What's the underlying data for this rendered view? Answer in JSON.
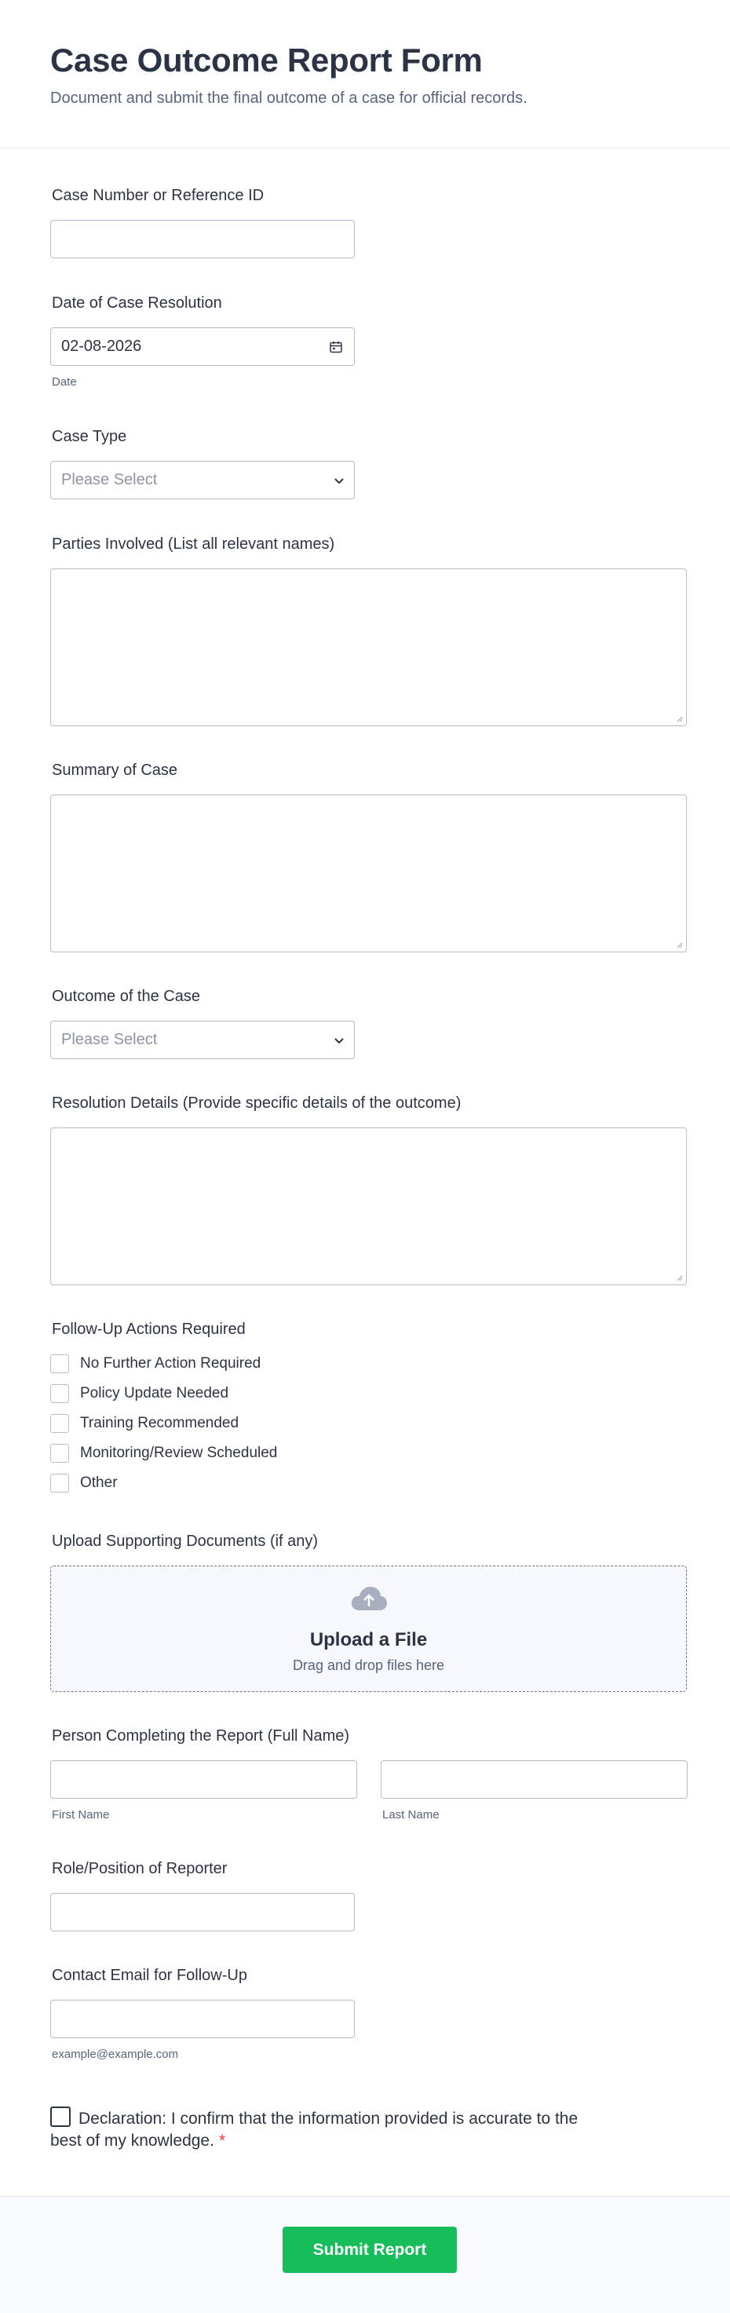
{
  "header": {
    "title": "Case Outcome Report Form",
    "subtitle": "Document and submit the final outcome of a case for official records."
  },
  "fields": {
    "case_number": {
      "label": "Case Number or Reference ID",
      "value": ""
    },
    "resolution_date": {
      "label": "Date of Case Resolution",
      "value": "02-08-2026",
      "sublabel": "Date",
      "icon": "calendar-icon"
    },
    "case_type": {
      "label": "Case Type",
      "placeholder": "Please Select"
    },
    "parties": {
      "label": "Parties Involved (List all relevant names)",
      "value": ""
    },
    "summary": {
      "label": "Summary of Case",
      "value": ""
    },
    "outcome": {
      "label": "Outcome of the Case",
      "placeholder": "Please Select"
    },
    "resolution_details": {
      "label": "Resolution Details (Provide specific details of the outcome)",
      "value": ""
    },
    "follow_up": {
      "label": "Follow-Up Actions Required",
      "options": [
        "No Further Action Required",
        "Policy Update Needed",
        "Training Recommended",
        "Monitoring/Review Scheduled",
        "Other"
      ]
    },
    "upload": {
      "label": "Upload Supporting Documents (if any)",
      "title": "Upload a File",
      "subtitle": "Drag and drop files here",
      "icon": "cloud-upload-icon"
    },
    "person": {
      "label": "Person Completing the Report (Full Name)",
      "first_sublabel": "First Name",
      "last_sublabel": "Last Name"
    },
    "role": {
      "label": "Role/Position of Reporter",
      "value": ""
    },
    "email": {
      "label": "Contact Email for Follow-Up",
      "sublabel": "example@example.com",
      "value": ""
    },
    "declaration": {
      "text": "Declaration: I confirm that the information provided is accurate to the best of my knowledge.",
      "required_mark": "*"
    }
  },
  "footer": {
    "submit_label": "Submit Report"
  },
  "colors": {
    "accent": "#18bd5b",
    "required": "#f23a3c",
    "text": "#2c3345"
  }
}
